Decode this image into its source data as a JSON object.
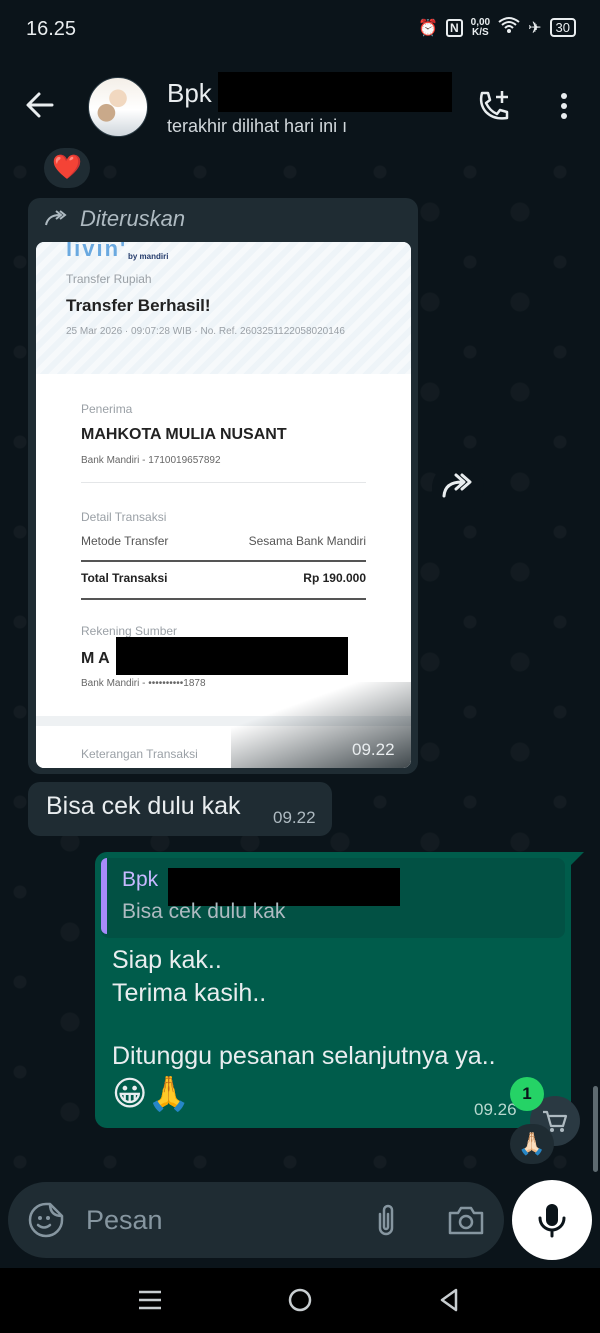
{
  "status_bar": {
    "time": "16.25",
    "net_speed_value": "0,00",
    "net_speed_unit": "K/S",
    "battery": "30"
  },
  "header": {
    "contact_name": "Bpk",
    "last_seen": "terakhir dilihat hari ini ı"
  },
  "messages": {
    "forwarded": {
      "label": "Diteruskan",
      "time": "09.22",
      "receipt": {
        "logo": "livin'",
        "logo_sub": "by mandiri",
        "subtitle": "Transfer Rupiah",
        "title": "Transfer Berhasil!",
        "date_ref": "25 Mar 2026 · 09:07:28 WIB · No. Ref. 260325112205802014­6",
        "recipient_label": "Penerima",
        "recipient_name": "MAHKOTA MULIA NUSANT",
        "recipient_bank": "Bank Mandiri - 1710019657892",
        "detail_label": "Detail Transaksi",
        "method_label": "Metode Transfer",
        "method_value": "Sesama Bank Mandiri",
        "total_label": "Total Transaksi",
        "total_value": "Rp 190.000",
        "source_label": "Rekening Sumber",
        "source_name": "M A",
        "source_bank": "Bank Mandiri - ••••••••••1878",
        "note_label": "Keterangan Transaksi"
      }
    },
    "incoming": {
      "text": "Bisa cek dulu kak",
      "time": "09.22"
    },
    "outgoing": {
      "quote_name": "Bpk",
      "quote_text": "Bisa cek dulu kak",
      "line1": "Siap kak..",
      "line2": "Terima kasih..",
      "line3": "Ditunggu pesanan selanjutnya ya..",
      "emoji": "😀🙏",
      "time": "09.26"
    }
  },
  "reactions": {
    "heart": "❤️",
    "pray": "🙏🏻"
  },
  "cart": {
    "badge_count": "1"
  },
  "composer": {
    "placeholder": "Pesan"
  },
  "colors": {
    "background": "#0b141a",
    "incoming_bubble": "#1f2c33",
    "outgoing_bubble": "#005c4b",
    "accent_green": "#25d366"
  }
}
